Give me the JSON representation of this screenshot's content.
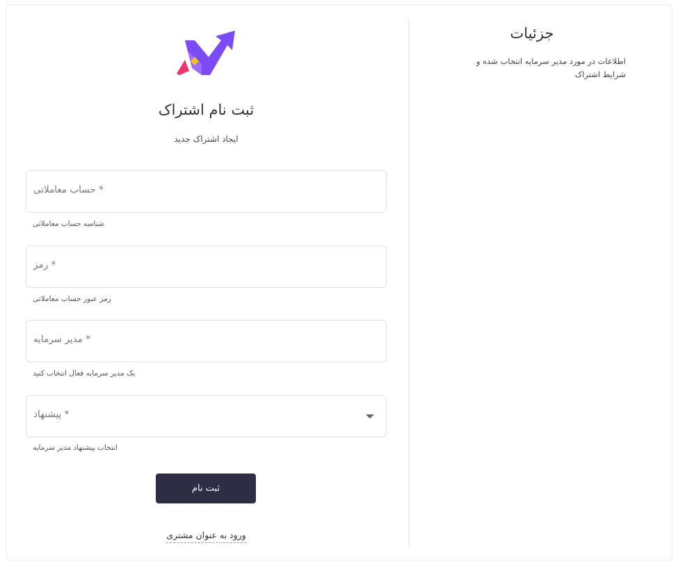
{
  "details": {
    "title": "جزئیات",
    "description": "اطلاعات در مورد مدیر سرمایه انتخاب شده و شرایط اشتراک"
  },
  "form": {
    "title": "ثبت نام اشتراک",
    "subtitle": "ایجاد اشتراک جدید",
    "fields": [
      {
        "label": "* حساب معاملاتی",
        "hint": "شناسه حساب معاملاتی"
      },
      {
        "label": "* رمز",
        "hint": "رمز عبور حساب معاملاتی"
      },
      {
        "label": "* مدیر سرمایه",
        "hint": "یک مدیر سرمایه فعال انتخاب کنید"
      },
      {
        "label": "* پیشنهاد",
        "hint": "انتخاب پیشنهاد مدیر سرمایه"
      }
    ],
    "submit_label": "ثبت نام",
    "login_link": "ورود به عنوان مشتری"
  },
  "colors": {
    "button_bg": "#2d2d44",
    "logo_purple": "#7b4cf5",
    "logo_pink": "#f0336b",
    "logo_yellow": "#f7c21e"
  },
  "icons": {
    "logo": "chart-arrow-logo",
    "dropdown": "chevron-down-icon"
  }
}
